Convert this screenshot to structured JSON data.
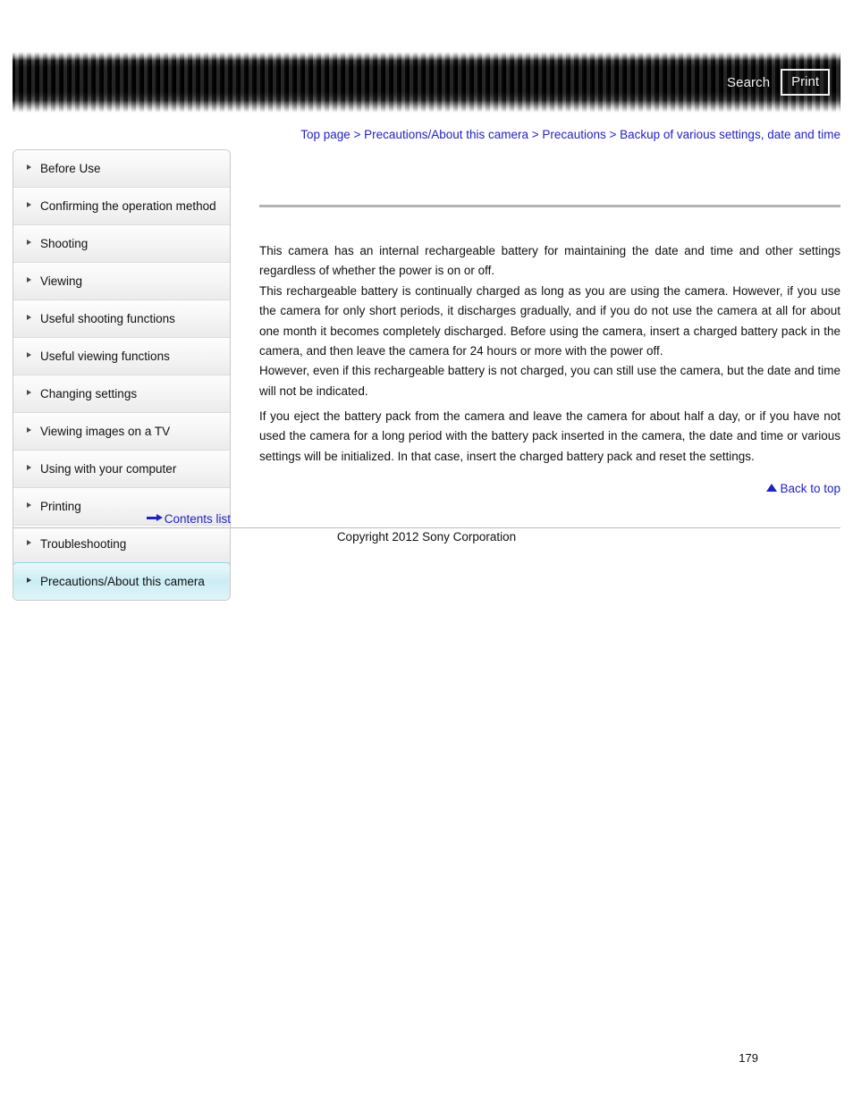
{
  "header": {
    "search_label": "Search",
    "print_label": "Print",
    "search_icon": "search-icon",
    "print_icon": "print-icon"
  },
  "breadcrumb": {
    "separator": " > ",
    "items": [
      "Top page",
      "Precautions/About this camera",
      "Precautions",
      "Backup of various settings, date and time"
    ]
  },
  "sidebar": {
    "items": [
      {
        "label": "Before Use",
        "active": false
      },
      {
        "label": "Confirming the operation method",
        "active": false
      },
      {
        "label": "Shooting",
        "active": false
      },
      {
        "label": "Viewing",
        "active": false
      },
      {
        "label": "Useful shooting functions",
        "active": false
      },
      {
        "label": "Useful viewing functions",
        "active": false
      },
      {
        "label": "Changing settings",
        "active": false
      },
      {
        "label": "Viewing images on a TV",
        "active": false
      },
      {
        "label": "Using with your computer",
        "active": false
      },
      {
        "label": "Printing",
        "active": false
      },
      {
        "label": "Troubleshooting",
        "active": false
      },
      {
        "label": "Precautions/About this camera",
        "active": true
      }
    ],
    "contents_list_label": "Contents list",
    "contents_list_icon": "arrow-right-icon"
  },
  "content": {
    "paragraph_1": "This camera has an internal rechargeable battery for maintaining the date and time and other settings regardless of whether the power is on or off.\nThis rechargeable battery is continually charged as long as you are using the camera. However, if you use the camera for only short periods, it discharges gradually, and if you do not use the camera at all for about one month it becomes completely discharged. Before using the camera, insert a charged battery pack in the camera, and then leave the camera for 24 hours or more with the power off.\nHowever, even if this rechargeable battery is not charged, you can still use the camera, but the date and time will not be indicated.",
    "paragraph_2": "If you eject the battery pack from the camera and leave the camera for about half a day, or if you have not used the camera for a long period with the battery pack inserted in the camera, the date and time or various settings will be initialized. In that case, insert the charged battery pack and reset the settings."
  },
  "back_to_top": {
    "label": "Back to top",
    "icon": "triangle-up-icon"
  },
  "footer": {
    "copyright": "Copyright 2012 Sony Corporation"
  },
  "page_number": "179",
  "colors": {
    "link": "#2121cc",
    "text": "#111111",
    "active_nav_bg": "#ccedf5",
    "active_nav_border": "#8fd6e8",
    "rule": "#b4b4b4"
  }
}
